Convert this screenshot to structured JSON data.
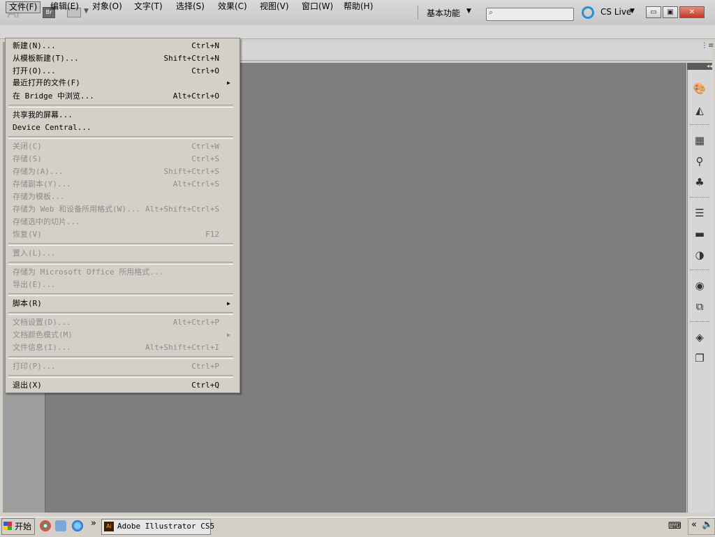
{
  "app": {
    "logo": "Ai",
    "bridge_label": "Br",
    "workspace": "基本功能",
    "cs_live": "CS Live",
    "search_placeholder": ""
  },
  "window_controls": {
    "minimize": "▭",
    "maximize": "▣",
    "close": "✕"
  },
  "menubar": [
    {
      "label": "文件(F)"
    },
    {
      "label": "编辑(E)"
    },
    {
      "label": "对象(O)"
    },
    {
      "label": "文字(T)"
    },
    {
      "label": "选择(S)"
    },
    {
      "label": "效果(C)"
    },
    {
      "label": "视图(V)"
    },
    {
      "label": "窗口(W)"
    },
    {
      "label": "帮助(H)"
    }
  ],
  "file_menu": [
    {
      "label": "新建(N)...",
      "shortcut": "Ctrl+N",
      "enabled": true
    },
    {
      "label": "从模板新建(T)...",
      "shortcut": "Shift+Ctrl+N",
      "enabled": true
    },
    {
      "label": "打开(O)...",
      "shortcut": "Ctrl+O",
      "enabled": true
    },
    {
      "label": "最近打开的文件(F)",
      "shortcut": "",
      "enabled": true,
      "submenu": true
    },
    {
      "label": "在 Bridge 中浏览...",
      "shortcut": "Alt+Ctrl+O",
      "enabled": true
    },
    {
      "label": "共享我的屏幕...",
      "shortcut": "",
      "enabled": true
    },
    {
      "label": "Device Central...",
      "shortcut": "",
      "enabled": true
    },
    {
      "label": "关闭(C)",
      "shortcut": "Ctrl+W",
      "enabled": false
    },
    {
      "label": "存储(S)",
      "shortcut": "Ctrl+S",
      "enabled": false
    },
    {
      "label": "存储为(A)...",
      "shortcut": "Shift+Ctrl+S",
      "enabled": false
    },
    {
      "label": "存储副本(Y)...",
      "shortcut": "Alt+Ctrl+S",
      "enabled": false
    },
    {
      "label": "存储为模板...",
      "shortcut": "",
      "enabled": false
    },
    {
      "label": "存储为 Web 和设备所用格式(W)...",
      "shortcut": "Alt+Shift+Ctrl+S",
      "enabled": false
    },
    {
      "label": "存储选中的切片...",
      "shortcut": "",
      "enabled": false
    },
    {
      "label": "恢复(V)",
      "shortcut": "F12",
      "enabled": false
    },
    {
      "label": "置入(L)...",
      "shortcut": "",
      "enabled": false
    },
    {
      "label": "存储为 Microsoft Office 所用格式...",
      "shortcut": "",
      "enabled": false
    },
    {
      "label": "导出(E)...",
      "shortcut": "",
      "enabled": false
    },
    {
      "label": "脚本(R)",
      "shortcut": "",
      "enabled": true,
      "submenu": true
    },
    {
      "label": "文档设置(D)...",
      "shortcut": "Alt+Ctrl+P",
      "enabled": false
    },
    {
      "label": "文档颜色模式(M)",
      "shortcut": "",
      "enabled": false,
      "submenu": true
    },
    {
      "label": "文件信息(I)...",
      "shortcut": "Alt+Shift+Ctrl+I",
      "enabled": false
    },
    {
      "label": "打印(P)...",
      "shortcut": "Ctrl+P",
      "enabled": false
    },
    {
      "label": "退出(X)",
      "shortcut": "Ctrl+Q",
      "enabled": true
    }
  ],
  "taskbar": {
    "start": "开始",
    "quicklaunch_more": "»",
    "task_app_icon": "Ai",
    "task_app": "Adobe Illustrator CS5",
    "tray_expand": "«"
  }
}
